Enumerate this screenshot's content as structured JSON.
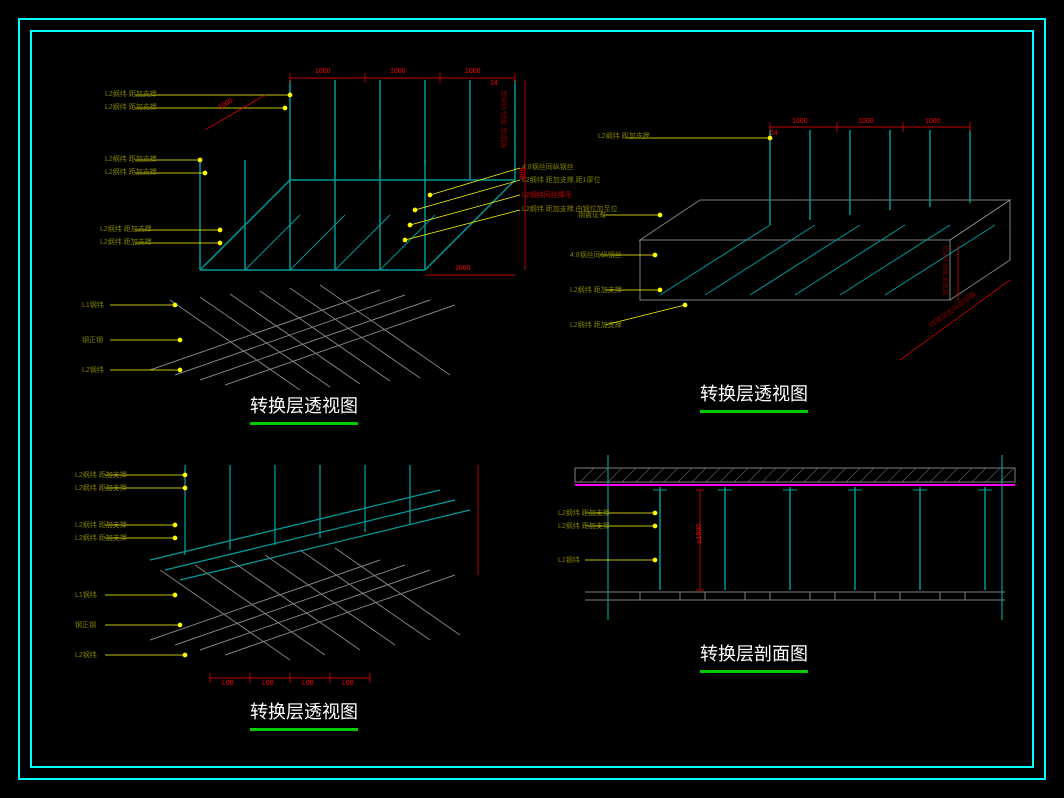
{
  "frame": {
    "outer_color": "#00ffff",
    "inner_color": "#00ffff"
  },
  "titles": {
    "t1": "转换层透视图",
    "t2": "转换层透视图",
    "t3": "转换层透视图",
    "t4": "转换层剖面图"
  },
  "labels": {
    "a1": "L2纲纬 距加支撑",
    "a2": "L2纲纬 距加支撑",
    "a3": "L2纲纬 距加支撑",
    "a4": "4:8钢丝同纵钢丝",
    "a5": "L2纲纬 距加支撑,距1厚位",
    "a6": "L2钢纬同丝降吊",
    "a7": "L2纲纬 距加支撑,由钢位加至位",
    "a8": "L1钢纬",
    "a9": "钢正钢",
    "a10": "L2钢纬",
    "b1": "L2纲纬 距加支撑",
    "b2": "钢置证有",
    "b3": "4:8钢丝同纵钢丝",
    "b4": "L2纲纬 距加支撑",
    "b5": "L2纲纬 距加支撑",
    "b6": "转换层击叫张钢鬓",
    "c1": "L2纲纬 距加支撑",
    "c2": "L2纲纬 距加支撑",
    "c3": "L1钢纬",
    "c4": "钢正钢",
    "c5": "L2钢纬",
    "d1": "L2纲纬 距加支撑",
    "d2": "L1钢纬"
  },
  "dims": {
    "d1000a": "1000",
    "d1000b": "1000",
    "d1000c": "1000",
    "d1000d": "1000",
    "d1000e": "1000",
    "d1000f": "1000",
    "d600": "600",
    "d14": "14",
    "dL00a": "L00",
    "dL00b": "L00",
    "dL00c": "L00",
    "dL00d": "L00",
    "dP1000": "≤1800",
    "vlabel": "纬吊平成距 转换层"
  },
  "colors": {
    "teal": "#009999",
    "cyan": "#00ffff",
    "gray": "#808080",
    "olive": "#808000",
    "yellow": "#ffff00",
    "green": "#00cc00",
    "red": "#ff0000",
    "darkred": "#800000",
    "magenta": "#ff00ff",
    "white": "#ffffff"
  }
}
